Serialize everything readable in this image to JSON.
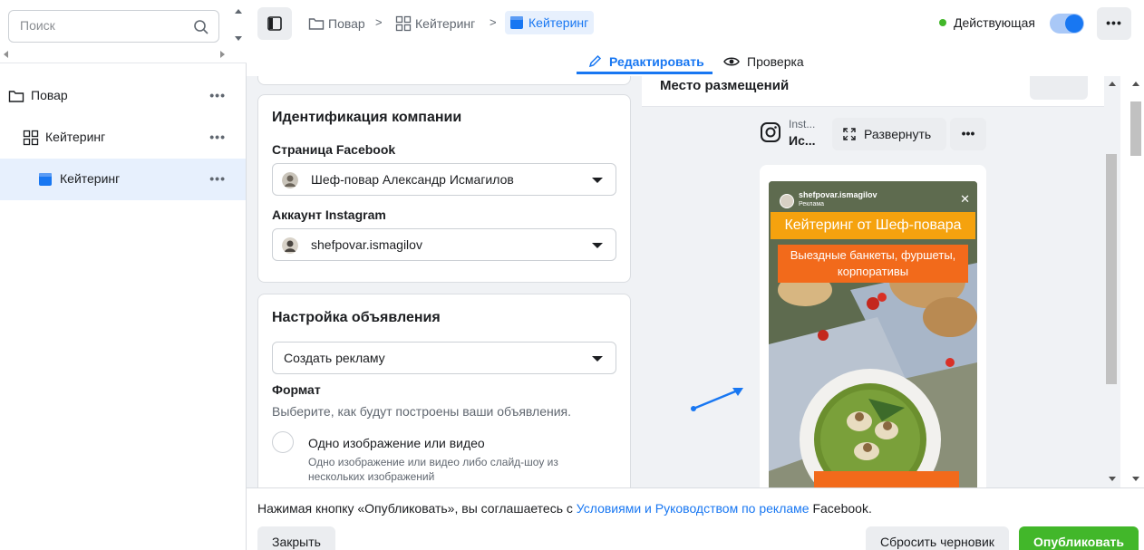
{
  "search": {
    "placeholder": "Поиск"
  },
  "tree": {
    "items": [
      {
        "label": "Повар",
        "icon": "folder-icon"
      },
      {
        "label": "Кейтеринг",
        "icon": "grid-icon"
      },
      {
        "label": "Кейтеринг",
        "icon": "ad-icon",
        "selected": true
      }
    ],
    "more": "•••"
  },
  "breadcrumbs": {
    "items": [
      "Повар",
      "Кейтеринг",
      "Кейтеринг"
    ],
    "separator": ">"
  },
  "status": {
    "label": "Действующая",
    "toggle_on": true
  },
  "top_more": "•••",
  "tabs": {
    "edit": "Редактировать",
    "review": "Проверка"
  },
  "company_card": {
    "title": "Идентификация компании",
    "facebook_label": "Страница Facebook",
    "facebook_value": "Шеф-повар Александр Исмагилов",
    "instagram_label": "Аккаунт Instagram",
    "instagram_value": "shefpovar.ismagilov"
  },
  "ad_card": {
    "title": "Настройка объявления",
    "mode_value": "Создать рекламу",
    "format_label": "Формат",
    "format_help": "Выберите, как будут построены ваши объявления.",
    "option1_title": "Одно изображение или видео",
    "option1_desc": "Одно изображение или видео либо слайд-шоу из нескольких изображений"
  },
  "preview": {
    "header_title": "Место размещений",
    "ig_name_top": "Inst...",
    "ig_name_bottom": "Ис...",
    "expand_label": "Развернуть",
    "more": "•••",
    "story_user": "shefpovar.ismagilov",
    "story_sponsored": "Реклама",
    "story_close": "✕",
    "story_title": "Кейтеринг от Шеф-повара",
    "story_sub": "Выездные банкеты, фуршеты, корпоративы"
  },
  "footer": {
    "text_prefix": "Нажимая кнопку «Опубликовать», вы соглашаетесь с ",
    "link1": "Условиями",
    "and": " и ",
    "link2": "Руководством по рекламе",
    "text_suffix": " Facebook.",
    "close": "Закрыть",
    "reset": "Сбросить черновик",
    "publish": "Опубликовать"
  },
  "colors": {
    "accent": "#1877f2",
    "publish": "#42b72a",
    "status_dot": "#42b72a",
    "story_title_bg": "#f5a20e",
    "story_sub_bg": "#f26a1b"
  }
}
